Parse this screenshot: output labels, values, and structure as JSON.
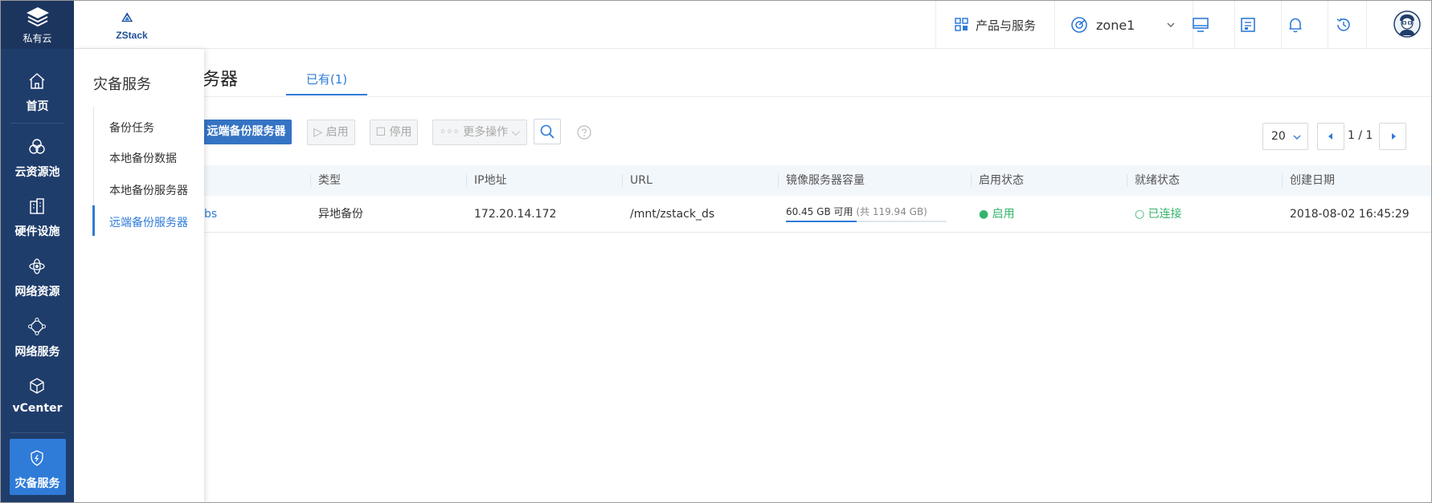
{
  "brand": {
    "label": "私有云"
  },
  "logo": {
    "text": "ZStack"
  },
  "nav": {
    "items": [
      {
        "label": "首页",
        "icon": "home-icon"
      },
      {
        "label": "云资源池",
        "icon": "cloud-pool-icon"
      },
      {
        "label": "硬件设施",
        "icon": "building-icon"
      },
      {
        "label": "网络资源",
        "icon": "network-resource-icon"
      },
      {
        "label": "网络服务",
        "icon": "network-service-icon"
      },
      {
        "label": "vCenter",
        "icon": "cube-icon"
      },
      {
        "label": "灾备服务",
        "icon": "shield-icon"
      }
    ]
  },
  "header": {
    "products_label": "产品与服务",
    "zone_label": "zone1"
  },
  "submenu": {
    "title": "灾备服务",
    "items": [
      {
        "label": "备份任务"
      },
      {
        "label": "本地备份数据"
      },
      {
        "label": "本地备份服务器"
      },
      {
        "label": "远端备份服务器"
      }
    ]
  },
  "page": {
    "title_partial": "务器",
    "tab_label": "已有(1)"
  },
  "toolbar": {
    "add_label": "远端备份服务器",
    "enable_label": "▷ 启用",
    "disable_label": "☐ 停用",
    "more_label": "◦◦◦ 更多操作 ⌵"
  },
  "pagination": {
    "page_size": "20",
    "page_text": "1 / 1"
  },
  "table": {
    "columns": [
      "类型",
      "IP地址",
      "URL",
      "镜像服务器容量",
      "启用状态",
      "就绪状态",
      "创建日期"
    ],
    "rows": [
      {
        "name_partial": "bs",
        "type": "异地备份",
        "ip": "172.20.14.172",
        "url": "/mnt/zstack_ds",
        "capacity_available": "60.45 GB 可用",
        "capacity_total": "(共 119.94 GB)",
        "capacity_used_fraction": 0.44,
        "enable_status": "● 启用",
        "ready_status": "○ 已连接",
        "created": "2018-08-02 16:45:29"
      }
    ]
  },
  "colors": {
    "nav_bg": "#1f3d6b",
    "accent": "#2f7bd8",
    "primary_button": "#3574c4",
    "success": "#35b46b"
  }
}
